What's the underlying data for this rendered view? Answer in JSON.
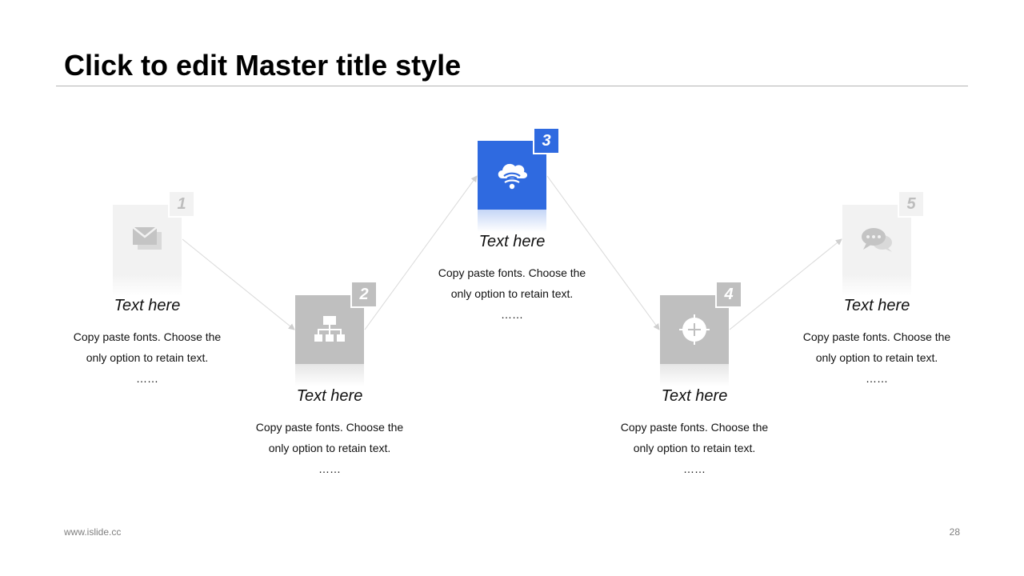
{
  "slide": {
    "title": "Click to edit Master title style",
    "footer_url": "www.islide.cc",
    "page_number": "28"
  },
  "steps": [
    {
      "number": "1",
      "heading": "Text here",
      "line1": "Copy paste fonts. Choose the",
      "line2": "only option to retain text.",
      "ellipsis": "……",
      "icon": "envelope-icon",
      "color": "#f2f2f2"
    },
    {
      "number": "2",
      "heading": "Text here",
      "line1": "Copy paste fonts. Choose the",
      "line2": "only option to retain text.",
      "ellipsis": "……",
      "icon": "sitemap-icon",
      "color": "#bfbfbf"
    },
    {
      "number": "3",
      "heading": "Text here",
      "line1": "Copy paste fonts. Choose the",
      "line2": "only option to retain text.",
      "ellipsis": "……",
      "icon": "cloud-wifi-icon",
      "color": "#2f6ae0"
    },
    {
      "number": "4",
      "heading": "Text here",
      "line1": "Copy paste fonts. Choose the",
      "line2": "only option to retain text.",
      "ellipsis": "……",
      "icon": "crosshair-icon",
      "color": "#bfbfbf"
    },
    {
      "number": "5",
      "heading": "Text here",
      "line1": "Copy paste fonts. Choose the",
      "line2": "only option to retain text.",
      "ellipsis": "……",
      "icon": "chat-bubbles-icon",
      "color": "#f2f2f2"
    }
  ]
}
